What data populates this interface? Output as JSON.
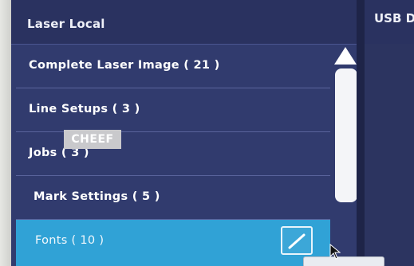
{
  "left_panel": {
    "title": "Laser Local",
    "items": [
      {
        "label": "Complete Laser Image ( 21 )"
      },
      {
        "label": "Line Setups ( 3 )"
      },
      {
        "label": "Jobs ( 3 )"
      },
      {
        "label": "Mark Settings ( 5 )"
      },
      {
        "label": "Fonts ( 10 )",
        "selected": true
      }
    ]
  },
  "right_panel": {
    "title": "USB D"
  },
  "watermark": {
    "badge_text": "CHEEF"
  },
  "icons": {
    "scroll_up": "triangle-up-icon",
    "edit": "pencil-icon",
    "cursor": "mouse-pointer-icon"
  },
  "colors": {
    "panel_bg": "#313b6e",
    "header_bg": "#2a3260",
    "selected_bg": "#30a2d6",
    "row_divider": "#5a649c",
    "scroll_thumb": "#f4f5f8"
  }
}
